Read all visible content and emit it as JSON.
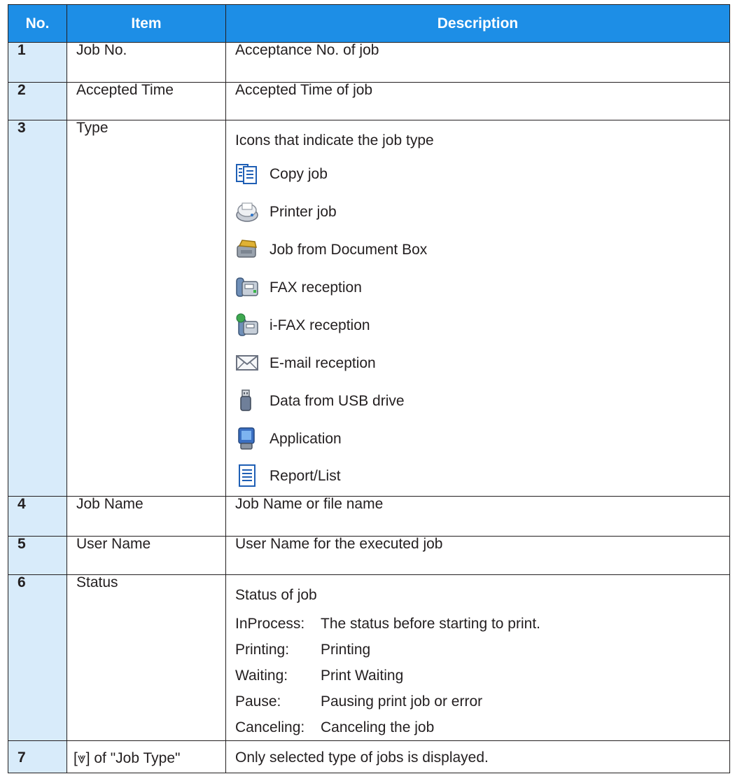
{
  "table": {
    "headers": {
      "no": "No.",
      "item": "Item",
      "description": "Description"
    },
    "rows": [
      {
        "no": "1",
        "item": "Job No.",
        "description": "Acceptance No. of job"
      },
      {
        "no": "2",
        "item": "Accepted Time",
        "description": "Accepted Time of job"
      },
      {
        "no": "3",
        "item": "Type",
        "description": "Icons that indicate the job type",
        "types": [
          {
            "icon": "copy-job-icon",
            "label": "Copy job"
          },
          {
            "icon": "printer-job-icon",
            "label": "Printer job"
          },
          {
            "icon": "document-box-icon",
            "label": "Job from Document Box"
          },
          {
            "icon": "fax-reception-icon",
            "label": "FAX reception"
          },
          {
            "icon": "ifax-reception-icon",
            "label": "i-FAX reception"
          },
          {
            "icon": "email-reception-icon",
            "label": "E-mail reception"
          },
          {
            "icon": "usb-drive-icon",
            "label": "Data from USB drive"
          },
          {
            "icon": "application-icon",
            "label": "Application"
          },
          {
            "icon": "report-list-icon",
            "label": "Report/List"
          }
        ]
      },
      {
        "no": "4",
        "item": "Job Name",
        "description": "Job Name or file name"
      },
      {
        "no": "5",
        "item": "User Name",
        "description": "User Name for the executed job"
      },
      {
        "no": "6",
        "item": "Status",
        "description": "Status of job",
        "statuses": [
          {
            "label": "InProcess:",
            "text": "The status before starting to print."
          },
          {
            "label": "Printing:",
            "text": "Printing"
          },
          {
            "label": "Waiting:",
            "text": "Print Waiting"
          },
          {
            "label": "Pause:",
            "text": "Pausing print job or error"
          },
          {
            "label": "Canceling:",
            "text": "Canceling the job"
          }
        ]
      },
      {
        "no": "7",
        "item_prefix": "[",
        "item_glyph": "⩔",
        "item_suffix": "] of \"Job Type\"",
        "description": "Only selected type of jobs is displayed."
      }
    ]
  },
  "colors": {
    "header_bg": "#1d8ee6",
    "number_cell_bg": "#d8ebfa",
    "border": "#231f20"
  }
}
